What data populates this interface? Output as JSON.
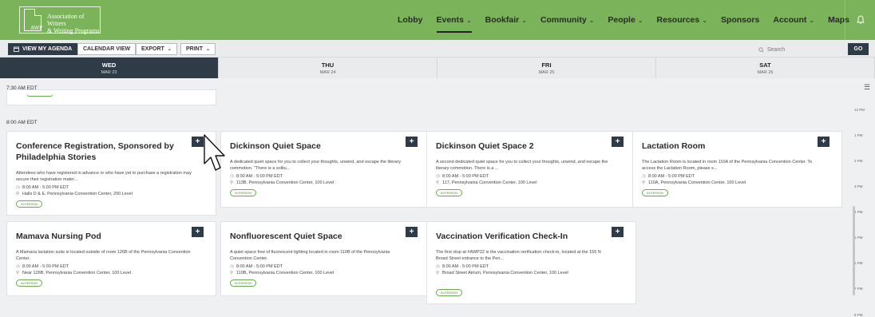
{
  "topnav": {
    "logo_awp": "AWP",
    "logo_line1": "Association of Writers",
    "logo_line2": "& Writing Programs",
    "items": [
      {
        "label": "Lobby",
        "has_chevron": false
      },
      {
        "label": "Events",
        "has_chevron": true,
        "active": true
      },
      {
        "label": "Bookfair",
        "has_chevron": true
      },
      {
        "label": "Community",
        "has_chevron": true
      },
      {
        "label": "People",
        "has_chevron": true
      },
      {
        "label": "Resources",
        "has_chevron": true
      },
      {
        "label": "Sponsors",
        "has_chevron": false
      },
      {
        "label": "Account",
        "has_chevron": true
      },
      {
        "label": "Maps",
        "has_chevron": false
      }
    ],
    "chevron": "⌄"
  },
  "toolbar": {
    "agenda_label": "VIEW MY AGENDA",
    "calendar_label": "CALENDAR VIEW",
    "export_label": "EXPORT",
    "print_label": "PRINT",
    "search_placeholder": "Search",
    "go_label": "GO"
  },
  "days": [
    {
      "name": "WED",
      "date": "MAR 23"
    },
    {
      "name": "THU",
      "date": "MAR 24"
    },
    {
      "name": "FRI",
      "date": "MAR 25"
    },
    {
      "name": "SAT",
      "date": "MAR 26"
    }
  ],
  "time_slots": {
    "first": "7:30 AM EDT",
    "second": "8:00 AM EDT"
  },
  "events": [
    {
      "title": "Conference Registration, Sponsored by Philadelphia Stories",
      "desc": "Attendees who have registered in advance or who have yet to purchase a registration may secure their registration mater...",
      "time": "8:00 AM - 5:00 PM EDT",
      "location": "Halls D & E, Pennsylvania Convention Center, 200 Level",
      "badge": "IN-PERSON"
    },
    {
      "title": "Dickinson Quiet Space",
      "desc": "A dedicated quiet space for you to collect your thoughts, unwind, and escape the literary commotion. \"There is a solitu...",
      "time": "8:00 AM - 5:00 PM EDT",
      "location": "113B, Pennsylvania Convention Center, 100 Level",
      "badge": "IN-PERSON"
    },
    {
      "title": "Dickinson Quiet Space 2",
      "desc": "A second dedicated quiet space for you to collect your thoughts, unwind, and escape the literary commotion. There is a ...",
      "time": "8:00 AM - 5:00 PM EDT",
      "location": "117, Pennsylvania Convention Center, 100 Level",
      "badge": "IN-PERSON"
    },
    {
      "title": "Lactation Room",
      "desc": "The Lactation Room is located in room 110A of the Pennsylvania Convention Center. To access the Lactation Room, please s...",
      "time": "8:00 AM - 5:00 PM EDT",
      "location": "110A, Pennsylvania Convention Center, 100 Level",
      "badge": "IN-PERSON"
    },
    {
      "title": "Mamava Nursing Pod",
      "desc": "A Mamava lactation suite is located outside of room 126B of the Pennsylvania Convention Center.",
      "time": "8:00 AM - 5:00 PM EDT",
      "location": "Near 126B, Pennsylvania Convention Center, 100 Level",
      "badge": "IN-PERSON"
    },
    {
      "title": "Nonfluorescent Quiet Space",
      "desc": "A quiet space free of fluorescent lighting located in room 110B of the Pennsylvania Convention Center.",
      "time": "8:00 AM - 5:00 PM EDT",
      "location": "110B, Pennsylvania Convention Center, 100 Level",
      "badge": "IN-PERSON"
    },
    {
      "title": "Vaccination Verification Check-In",
      "desc": "The first stop at #AWP22 is the vaccination verification check-in, located at the 155 N Broad Street entrance to the Pen...",
      "time": "8:00 AM - 5:00 PM EDT",
      "location": "Broad Street Atrium, Pennsylvania Convention Center, 100 Level",
      "badge": "IN-PERSON"
    }
  ],
  "plus_label": "+",
  "gutter_times": [
    "12 PM",
    "1 PM",
    "2 PM",
    "3 PM",
    "4 PM",
    "5 PM",
    "6 PM",
    "7 PM",
    "8 PM"
  ],
  "colors": {
    "brand_green": "#7bb35a",
    "navy": "#2f3b47",
    "badge_green": "#6aa84f"
  }
}
